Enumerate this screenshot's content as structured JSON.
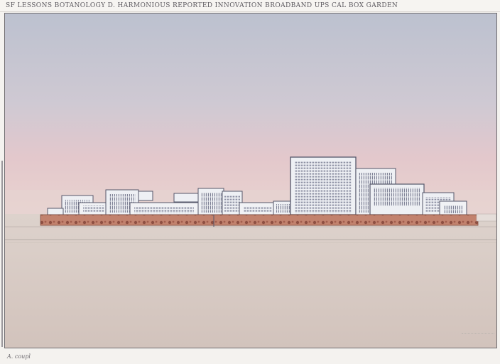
{
  "header": {
    "caption": "SF  LESSONS  BOTANOLOGY  D.  HARMONIOUS  REPORTED  INNOVATION  BROADBAND  UPS  CAL  BOX  GARDEN  "
  },
  "footer": {
    "signature": "A. coupl"
  },
  "scene": {
    "description_colors": {
      "sky_top": "#bfc3d0",
      "sky_mid": "#d9c9cf",
      "sky_horizon": "#e7c9c9",
      "ground": "#d7cbc4",
      "hedge": "#b9735f",
      "building_line": "#55576a",
      "building_fill": "#eef0f4"
    }
  }
}
